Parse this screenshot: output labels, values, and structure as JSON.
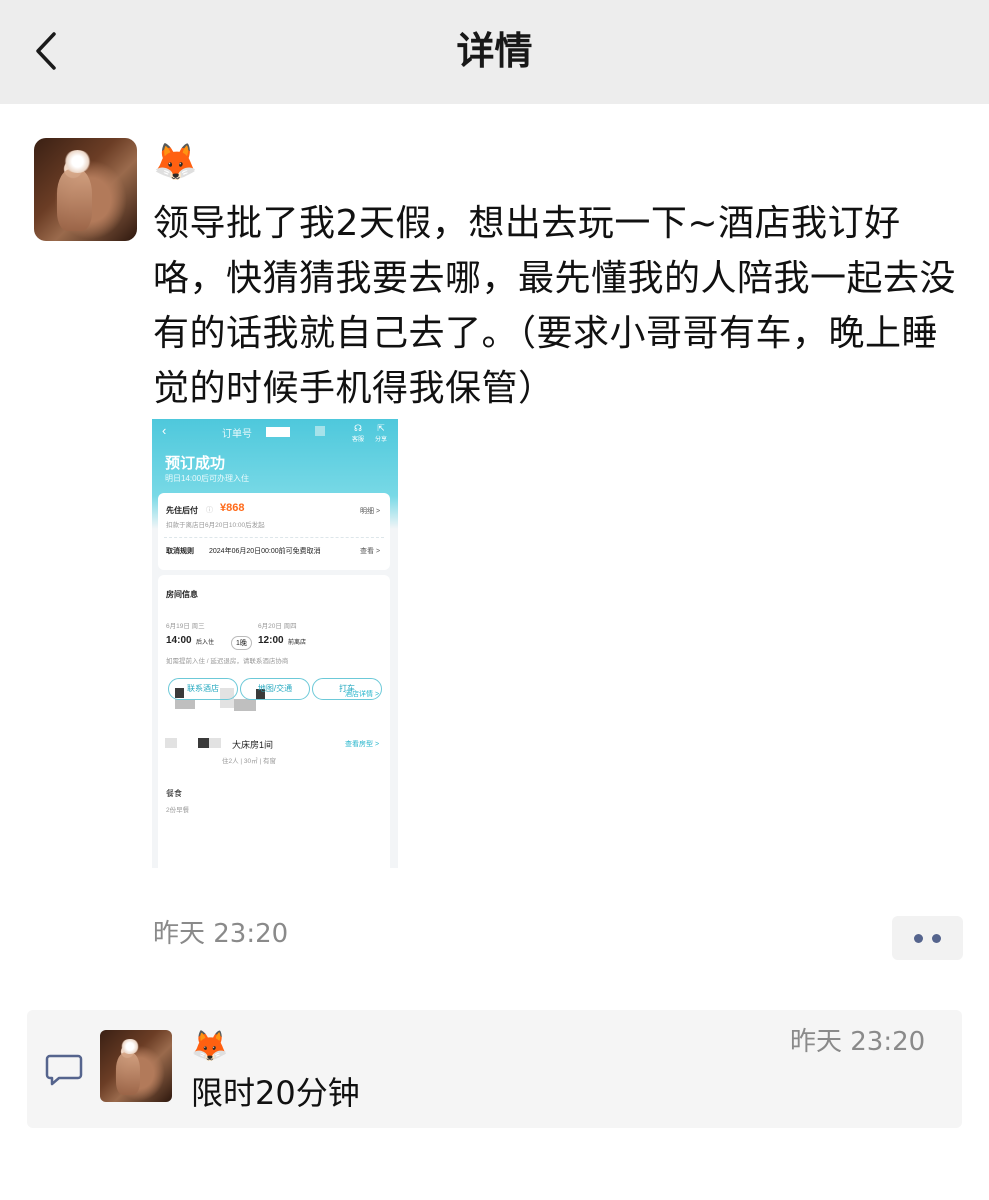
{
  "header": {
    "title": "详情"
  },
  "post": {
    "author_emoji": "🦊",
    "text": "领导批了我2天假，想出去玩一下~酒店我订好咯，快猜猜我要去哪，最先懂我的人陪我一起去没有的话我就自己去了。（要求小哥哥有车，晚上睡觉的时候手机得我保管）",
    "time": "昨天 23:20",
    "screenshot": {
      "order_label": "订单号",
      "icons": [
        {
          "name": "客服",
          "glyph": "☊"
        },
        {
          "name": "分享",
          "glyph": "⇱"
        }
      ],
      "title": "预订成功",
      "subtitle": "明日14:00后可办理入住",
      "pay_label": "先住后付",
      "price": "¥868",
      "detail_link": "明细 >",
      "deduct_note": "扣款于离店日6月20日10:00后发起",
      "cancel_label": "取消规则",
      "cancel_text": "2024年06月20日00:00前可免费取消",
      "cancel_link": "查看 >",
      "room_info_title": "房间信息",
      "checkin_date": "6月19日 周三",
      "checkout_date": "6月20日 周四",
      "checkin_time": "14:00",
      "checkin_suffix": "后入住",
      "nights": "1晚",
      "checkout_time": "12:00",
      "checkout_suffix": "前离店",
      "stay_note": "如需提前入住 / 延迟退房，请联系酒店协商",
      "hotel_link": "酒店详情 >",
      "room_name": "大床房1间",
      "room_spec": "住2人 | 30㎡ | 有窗",
      "room_link": "查看房型 >",
      "meal_title": "餐食",
      "meal_text": "2份早餐",
      "buttons": [
        "联系酒店",
        "地图/交通",
        "打车"
      ]
    }
  },
  "comment": {
    "author_emoji": "🦊",
    "time": "昨天 23:20",
    "text": "限时20分钟"
  }
}
